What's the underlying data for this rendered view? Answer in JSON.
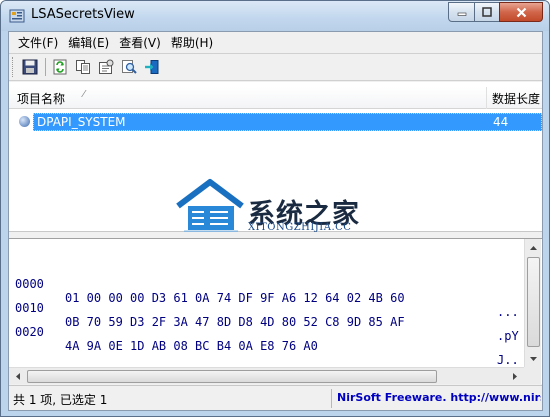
{
  "window": {
    "title": "LSASecretsView",
    "icon": "lsa-app-icon"
  },
  "menu": {
    "items": [
      "文件(F)",
      "编辑(E)",
      "查看(V)",
      "帮助(H)"
    ]
  },
  "toolbar": {
    "buttons": [
      "save-icon",
      "refresh-icon",
      "copy-icon",
      "properties-icon",
      "find-icon",
      "exit-icon"
    ]
  },
  "list": {
    "columns": [
      "项目名称",
      "数据长度"
    ],
    "rows": [
      {
        "name": "DPAPI_SYSTEM",
        "length": "44"
      }
    ],
    "selected_color": "#3399ff"
  },
  "watermark": {
    "text": "系统之家",
    "subtext": "XITONGZHIJIA.CC",
    "color": "#1a70c0"
  },
  "hex": {
    "lines": [
      {
        "offset": "0000",
        "bytes": "01 00 00 00 D3 61 0A 74 DF 9F A6 12 64 02 4B 60",
        "ascii": "..."
      },
      {
        "offset": "0010",
        "bytes": "0B 70 59 D3 2F 3A 47 8D D8 4D 80 52 C8 9D 85 AF",
        "ascii": ".pY"
      },
      {
        "offset": "0020",
        "bytes": "4A 9A 0E 1D AB 08 BC B4 0A E8 76 A0",
        "ascii": "J.."
      }
    ],
    "text_color": "#000080"
  },
  "status": {
    "left": "共 1 项, 已选定 1",
    "right": "NirSoft Freeware.  http://www.nirsoft.net"
  }
}
